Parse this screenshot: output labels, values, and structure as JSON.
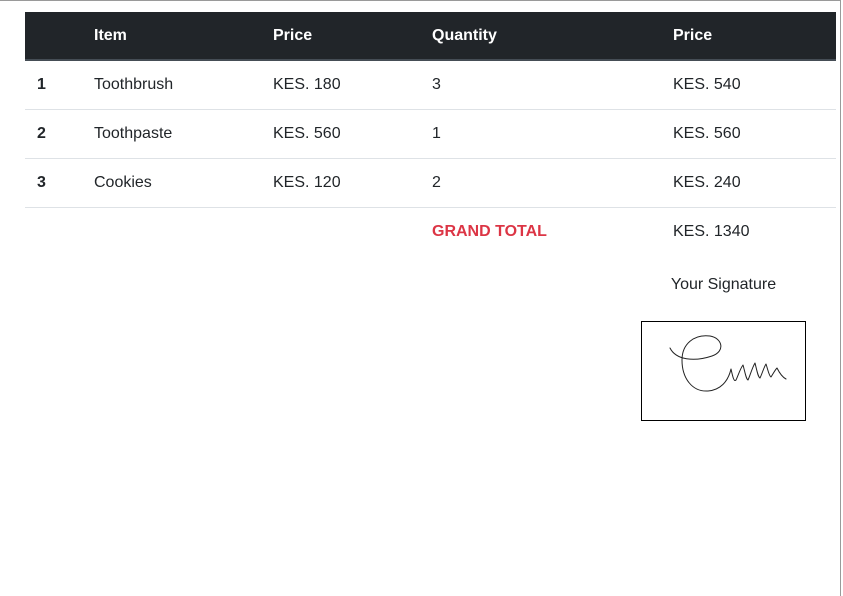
{
  "table": {
    "headers": [
      "",
      "Item",
      "Price",
      "Quantity",
      "Price"
    ],
    "rows": [
      {
        "num": "1",
        "item": "Toothbrush",
        "price": "KES. 180",
        "quantity": "3",
        "total": "KES. 540"
      },
      {
        "num": "2",
        "item": "Toothpaste",
        "price": "KES. 560",
        "quantity": "1",
        "total": "KES. 560"
      },
      {
        "num": "3",
        "item": "Cookies",
        "price": "KES. 120",
        "quantity": "2",
        "total": "KES. 240"
      }
    ],
    "grand_total_label": "GRAND TOTAL",
    "grand_total_value": "KES. 1340"
  },
  "signature": {
    "label": "Your Signature"
  },
  "colors": {
    "header_bg": "#212529",
    "grand_total_label": "#dc3545"
  }
}
